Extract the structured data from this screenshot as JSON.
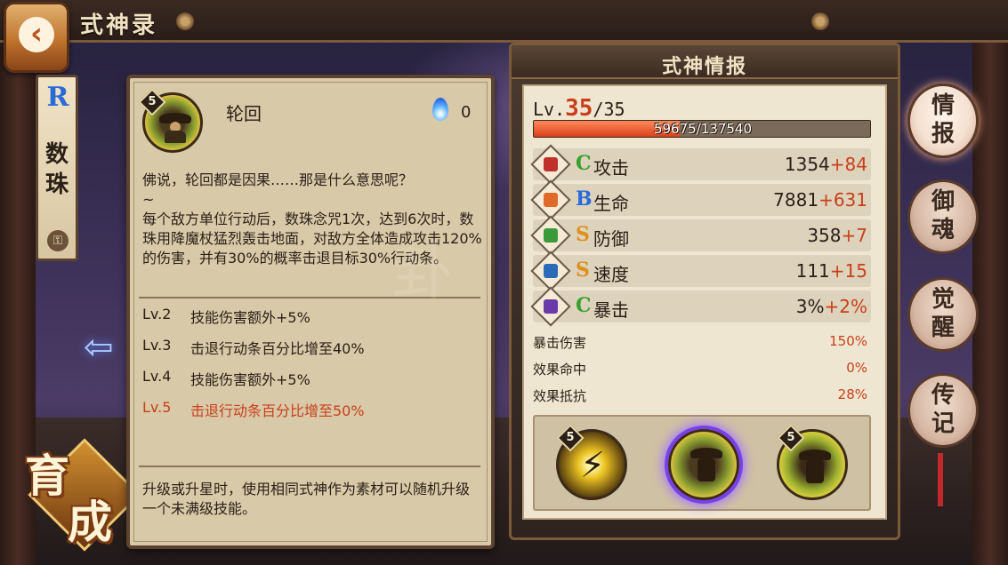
{
  "header": {
    "title": "式神录",
    "back_icon": "back-arrow-icon"
  },
  "shikigami_tab": {
    "rarity": "R",
    "name_line1": "数",
    "name_line2": "珠"
  },
  "bottom_badge": {
    "char1": "育",
    "char2": "成"
  },
  "skill": {
    "level": "5",
    "name": "轮回",
    "onmyo_cost": "0",
    "description": "佛说，轮回都是因果……那是什么意思呢？\n~\n每个敌方单位行动后，数珠念咒1次，达到6次时，数珠用降魔杖猛烈轰击地面，对敌方全体造成攻击120%的伤害，并有30%的概率击退目标30%行动条。",
    "levels": [
      {
        "lv": "Lv.2",
        "text": "技能伤害额外+5%",
        "active": false
      },
      {
        "lv": "Lv.3",
        "text": "击退行动条百分比增至40%",
        "active": false
      },
      {
        "lv": "Lv.4",
        "text": "技能伤害额外+5%",
        "active": false
      },
      {
        "lv": "Lv.5",
        "text": "击退行动条百分比增至50%",
        "active": true
      }
    ],
    "upgrade_note": "升级或升星时，使用相同式神作为素材可以随机升级一个未满级技能。"
  },
  "info": {
    "title": "式神情报",
    "lv_prefix": "Lv.",
    "lv_current": "35",
    "lv_max": "/35",
    "exp_text": "59675/137540",
    "exp_fraction": 0.434,
    "stats": [
      {
        "grade": "C",
        "grade_color": "#3aa030",
        "name": "攻击",
        "base": "1354",
        "bonus": "+84",
        "icon": "attack-fan-icon",
        "icon_color": "#c0302a"
      },
      {
        "grade": "B",
        "grade_color": "#2a6ad8",
        "name": "生命",
        "base": "7881",
        "bonus": "+631",
        "icon": "health-talisman-icon",
        "icon_color": "#e06a2a"
      },
      {
        "grade": "S",
        "grade_color": "#e0901a",
        "name": "防御",
        "base": "358",
        "bonus": "+7",
        "icon": "defense-armor-icon",
        "icon_color": "#3a9a3a"
      },
      {
        "grade": "S",
        "grade_color": "#e0901a",
        "name": "速度",
        "base": "111",
        "bonus": "+15",
        "icon": "speed-boot-icon",
        "icon_color": "#2a6ab8"
      },
      {
        "grade": "C",
        "grade_color": "#3aa030",
        "name": "暴击",
        "base": "3%",
        "bonus": "+2%",
        "icon": "crit-scroll-icon",
        "icon_color": "#6a3aa8"
      }
    ],
    "sub_stats": [
      {
        "name": "暴击伤害",
        "value": "150%"
      },
      {
        "name": "效果命中",
        "value": "0%"
      },
      {
        "name": "效果抵抗",
        "value": "28%"
      }
    ],
    "skill_slots": [
      {
        "level": "5",
        "icon": "lightning-skill-icon"
      },
      {
        "level": "",
        "icon": "reincarnation-skill-icon"
      },
      {
        "level": "5",
        "icon": "monk-aura-skill-icon"
      }
    ]
  },
  "right_tabs": [
    {
      "line1": "情",
      "line2": "报",
      "active": true
    },
    {
      "line1": "御",
      "line2": "魂",
      "active": false
    },
    {
      "line1": "觉",
      "line2": "醒",
      "active": false
    },
    {
      "line1": "传",
      "line2": "记",
      "active": false
    }
  ]
}
